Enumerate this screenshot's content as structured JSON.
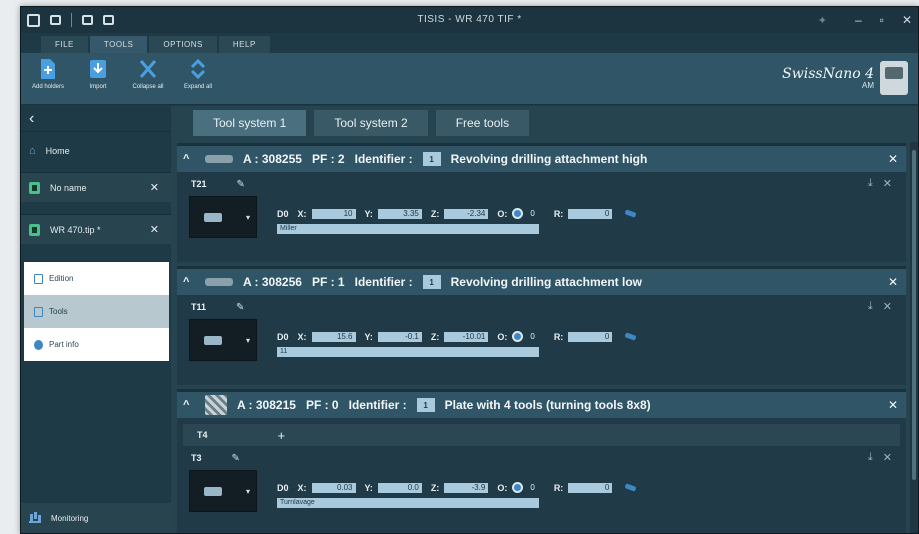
{
  "window": {
    "title": "TISIS - WR 470 TIF *"
  },
  "menu": {
    "tabs": [
      "FILE",
      "TOOLS",
      "OPTIONS",
      "HELP"
    ]
  },
  "ribbon": {
    "buttons": [
      {
        "label": "Add holders",
        "icon": "add-holder-icon"
      },
      {
        "label": "Import",
        "icon": "import-icon"
      },
      {
        "label": "Collapse all",
        "icon": "collapse-all-icon"
      },
      {
        "label": "Expand all",
        "icon": "expand-all-icon"
      }
    ]
  },
  "brand": {
    "name": "SwissNano 4",
    "sub": "AM"
  },
  "sidebar": {
    "home": "Home",
    "files": [
      "No name",
      "WR 470.tip *"
    ],
    "sub_items": [
      "Edition",
      "Tools",
      "Part info"
    ],
    "monitoring": "Monitoring"
  },
  "tabs": [
    "Tool system 1",
    "Tool system 2",
    "Free tools"
  ],
  "sections": [
    {
      "article": "A : 308255",
      "pf": "PF : 2",
      "identifier_label": "Identifier :",
      "identifier_value": "1",
      "name": "Revolving drilling attachment high",
      "tool": {
        "id": "T21",
        "d": "D0",
        "x": "10",
        "y": "3.35",
        "z": "-2.34",
        "o": "0",
        "r": "0",
        "comment": "Miller"
      }
    },
    {
      "article": "A : 308256",
      "pf": "PF : 1",
      "identifier_label": "Identifier :",
      "identifier_value": "1",
      "name": "Revolving drilling attachment low",
      "tool": {
        "id": "T11",
        "d": "D0",
        "x": "15.6",
        "y": "-0.1",
        "z": "-10.01",
        "o": "0",
        "r": "0",
        "comment": "11"
      }
    },
    {
      "article": "A : 308215",
      "pf": "PF : 0",
      "identifier_label": "Identifier :",
      "identifier_value": "1",
      "name": "Plate with 4 tools (turning tools 8x8)",
      "add_tool": "T4",
      "tool": {
        "id": "T3",
        "d": "D0",
        "x": "0.03",
        "y": "0.0",
        "z": "-3.9",
        "o": "0",
        "r": "0",
        "comment": "Turnlavage"
      }
    }
  ],
  "labels": {
    "x": "X:",
    "y": "Y:",
    "z": "Z:",
    "o": "O:",
    "r": "R:"
  },
  "colors": {
    "accent": "#3e87c7",
    "field": "#a9c9dc",
    "header": "#2f5566",
    "background": "#1f3a47"
  }
}
